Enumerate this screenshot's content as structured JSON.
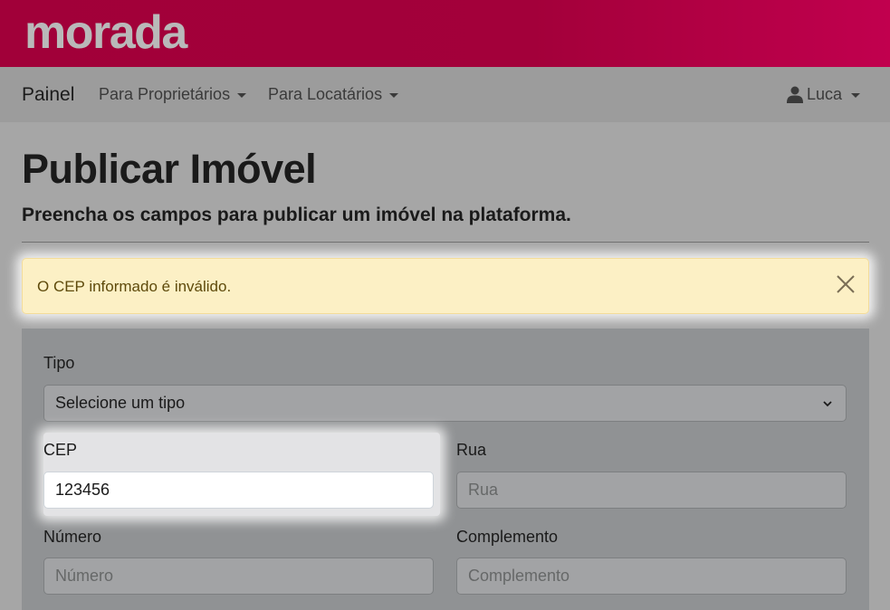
{
  "brand": {
    "logo_text": "morada"
  },
  "navbar": {
    "brand_label": "Painel",
    "menus": [
      {
        "label": "Para Proprietários"
      },
      {
        "label": "Para Locatários"
      }
    ],
    "user_label": "Luca"
  },
  "page": {
    "title": "Publicar Imóvel",
    "subtitle": "Preencha os campos para publicar um imóvel na plataforma."
  },
  "alert": {
    "message": "O CEP informado é inválido.",
    "type": "warning"
  },
  "form": {
    "tipo": {
      "label": "Tipo",
      "selected": "Selecione um tipo"
    },
    "cep": {
      "label": "CEP",
      "value": "123456"
    },
    "rua": {
      "label": "Rua",
      "placeholder": "Rua"
    },
    "numero": {
      "label": "Número",
      "placeholder": "Número"
    },
    "complemento": {
      "label": "Complemento",
      "placeholder": "Complemento"
    }
  },
  "colors": {
    "brand_bar": "#a3003a",
    "alert_bg": "#fcf0c5",
    "alert_text": "#5e4a0b"
  }
}
